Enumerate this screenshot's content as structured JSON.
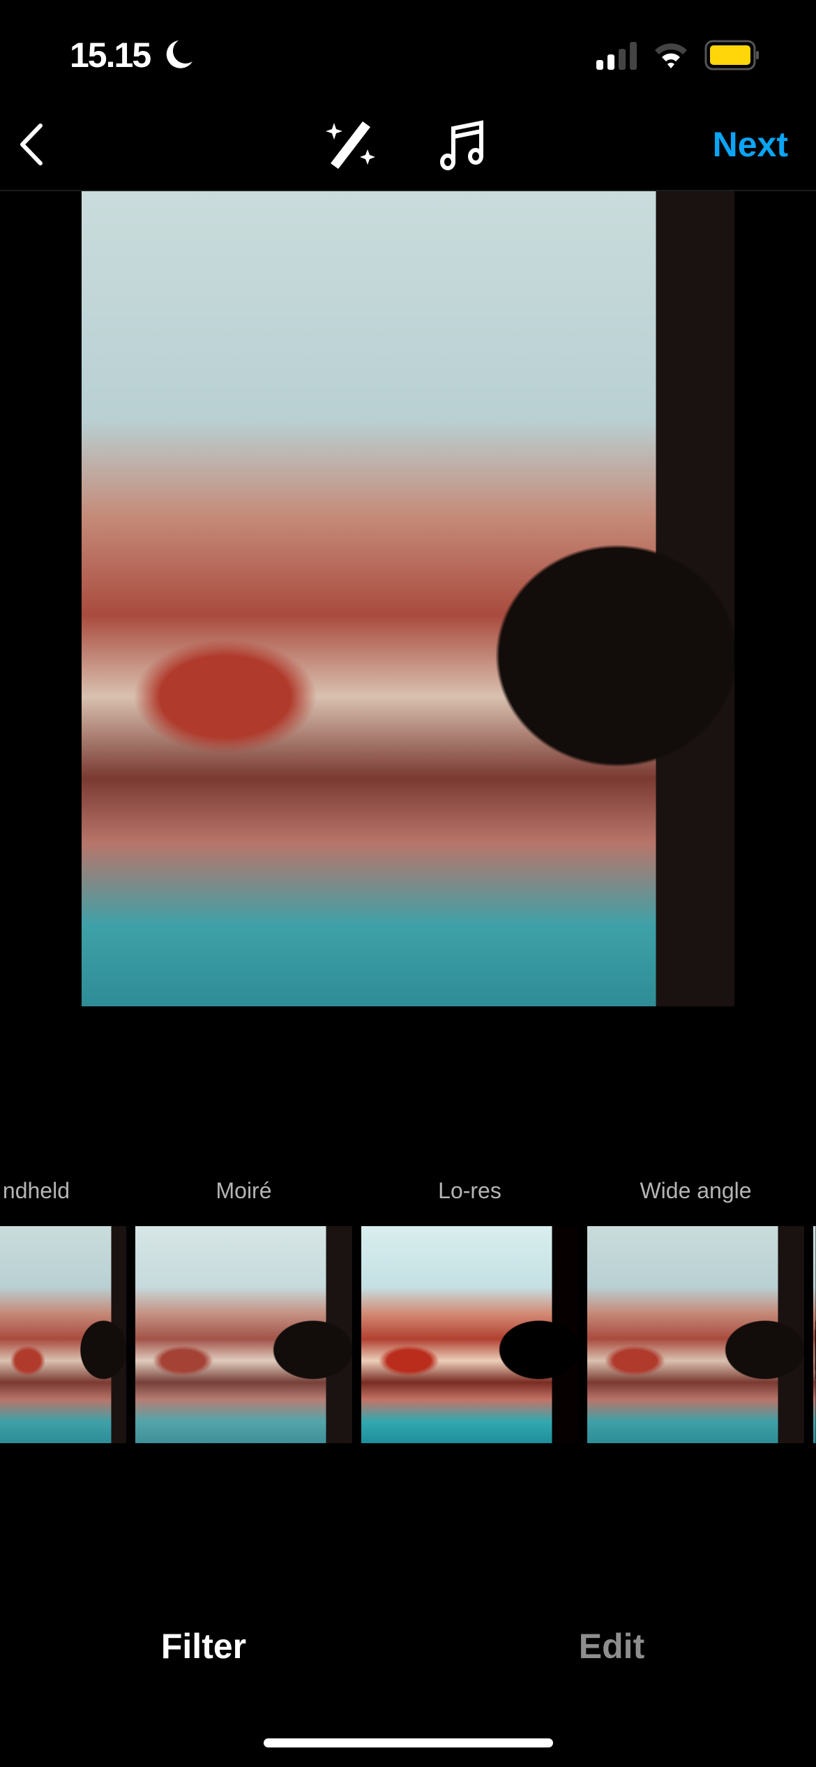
{
  "status_bar": {
    "time": "15.15",
    "icons": [
      "moon-icon",
      "signal-icon",
      "wifi-icon",
      "battery-icon"
    ],
    "battery_color": "#FFD60A"
  },
  "nav": {
    "back_icon": "chevron-left-icon",
    "tools": [
      "magic-wand-icon",
      "music-note-icon"
    ],
    "next_label": "Next",
    "accent": "#0AA5F7"
  },
  "filters": [
    {
      "label": "ndheld"
    },
    {
      "label": "Moiré"
    },
    {
      "label": "Lo-res"
    },
    {
      "label": "Wide angle"
    },
    {
      "label": ""
    }
  ],
  "tabs": {
    "filter": "Filter",
    "edit": "Edit",
    "active": "Filter"
  }
}
